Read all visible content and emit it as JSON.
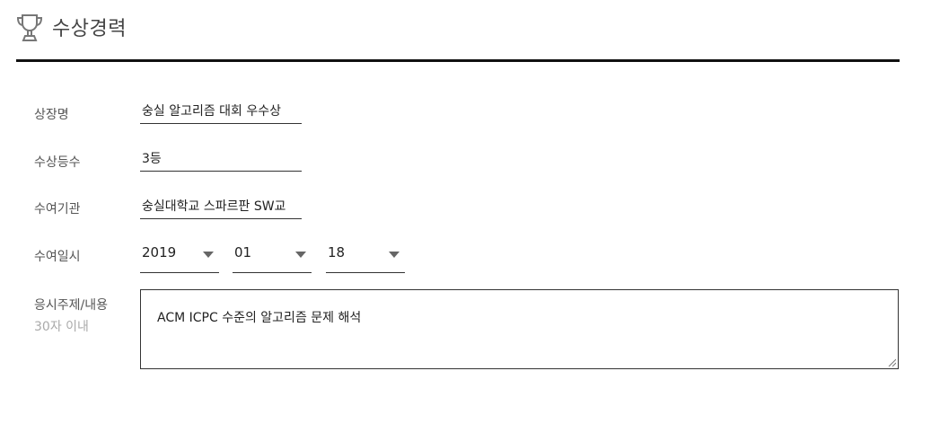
{
  "section": {
    "title": "수상경력"
  },
  "form": {
    "award_name": {
      "label": "상장명",
      "value": "숭실 알고리즘 대회 우수상"
    },
    "award_rank": {
      "label": "수상등수",
      "value": "3등"
    },
    "issuer": {
      "label": "수여기관",
      "value": "숭실대학교 스파르판 SW교"
    },
    "award_date": {
      "label": "수여일시",
      "year": "2019",
      "month": "01",
      "day": "18"
    },
    "subject": {
      "label": "응시주제/내용",
      "hint": "30자 이내",
      "value": "ACM ICPC 수준의 알고리즘 문제 해석"
    }
  },
  "icons": {
    "header": "trophy-icon",
    "select": "chevron-down-icon"
  }
}
